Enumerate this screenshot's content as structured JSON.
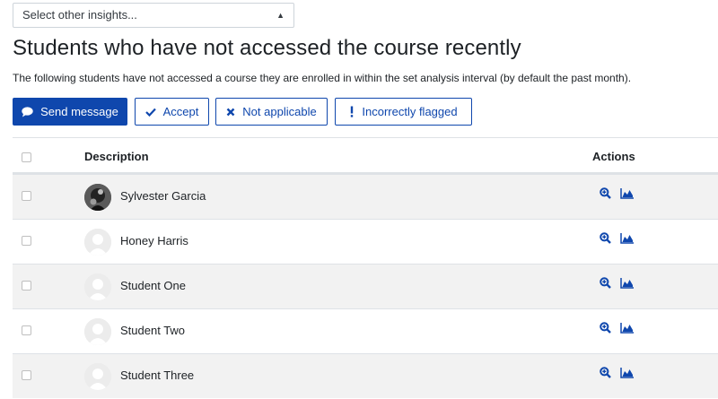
{
  "insight_select": {
    "value": "Select other insights..."
  },
  "page": {
    "title": "Students who have not accessed the course recently",
    "description": "The following students have not accessed a course they are enrolled in within the set analysis interval (by default the past month)."
  },
  "toolbar": {
    "send_message": "Send message",
    "accept": "Accept",
    "not_applicable": "Not applicable",
    "incorrectly_flagged": "Incorrectly flagged"
  },
  "table": {
    "headers": {
      "description": "Description",
      "actions": "Actions"
    },
    "rows": [
      {
        "name": "Sylvester Garcia",
        "avatar": "photo"
      },
      {
        "name": "Honey Harris",
        "avatar": "default-user"
      },
      {
        "name": "Student One",
        "avatar": "default-user"
      },
      {
        "name": "Student Two",
        "avatar": "default-user"
      },
      {
        "name": "Student Three",
        "avatar": "default-user"
      }
    ]
  },
  "icons": {
    "row_actions": [
      "zoom-in-icon",
      "area-chart-icon"
    ]
  },
  "colors": {
    "primary": "#0f47ad",
    "stripe": "#f2f2f2",
    "border": "#dee2e6"
  }
}
